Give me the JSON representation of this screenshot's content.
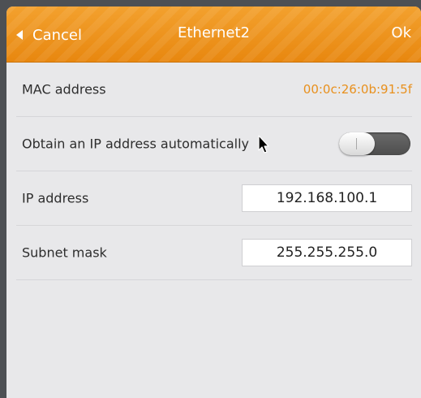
{
  "header": {
    "cancel_label": "Cancel",
    "title": "Ethernet2",
    "ok_label": "Ok"
  },
  "rows": {
    "mac": {
      "label": "MAC address",
      "value": "00:0c:26:0b:91:5f"
    },
    "auto_ip": {
      "label": "Obtain an IP address automatically",
      "enabled": false
    },
    "ip": {
      "label": "IP address",
      "value": "192.168.100.1"
    },
    "subnet": {
      "label": "Subnet mask",
      "value": "255.255.255.0"
    }
  },
  "colors": {
    "header_orange": "#ee9420",
    "mac_value": "#e8901d",
    "background": "#e8e8ea"
  },
  "icons": {
    "back": "chevron-left-icon",
    "pointer": "mouse-cursor-icon"
  }
}
